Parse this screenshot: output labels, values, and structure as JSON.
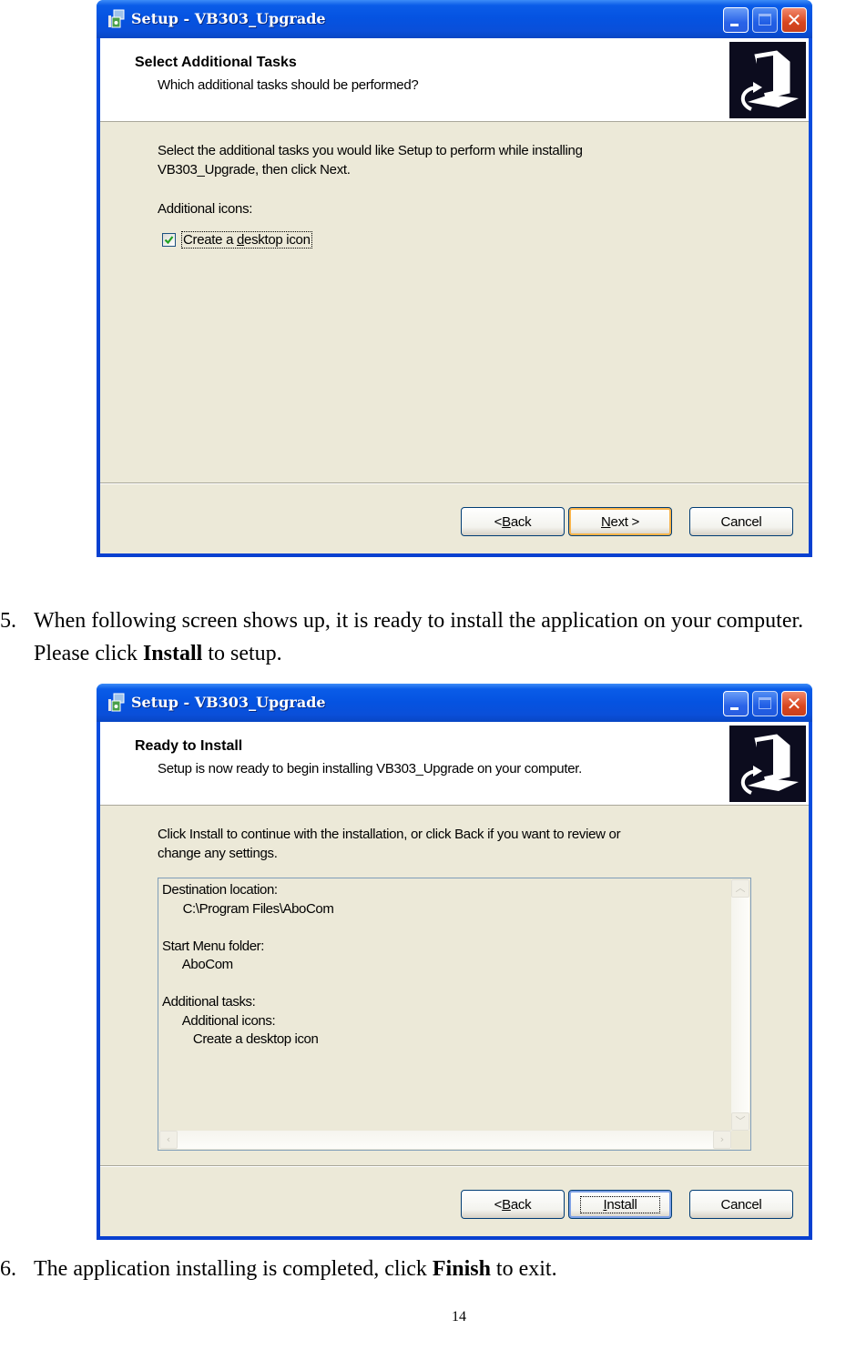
{
  "window1": {
    "title": "Setup - VB303_Upgrade",
    "header_title": "Select Additional Tasks",
    "header_subtitle": "Which additional tasks should be performed?",
    "body_line1": "Select the additional tasks you would like Setup to perform while installing",
    "body_line2": "VB303_Upgrade, then click Next.",
    "group_label": "Additional icons:",
    "checkbox": {
      "label_pre": "Create a ",
      "label_accel": "d",
      "label_post": "esktop icon",
      "checked": true
    },
    "buttons": {
      "back_pre": "< ",
      "back_accel": "B",
      "back_post": "ack",
      "next_accel": "N",
      "next_post": "ext >",
      "cancel": "Cancel"
    }
  },
  "step5": {
    "number": "5.",
    "text_pre": "When following screen shows up, it is ready to install the application on your computer. Please click ",
    "text_bold": "Install",
    "text_post": " to setup."
  },
  "window2": {
    "title": "Setup - VB303_Upgrade",
    "header_title": "Ready to Install",
    "header_subtitle": "Setup is now ready to begin installing VB303_Upgrade on your computer.",
    "body_line1": "Click Install to continue with the installation, or click Back if you want to review or",
    "body_line2": "change any settings.",
    "memo_lines": [
      "Destination location:",
      "      C:\\Program Files\\AboCom",
      "",
      "Start Menu folder:",
      "      AboCom",
      "",
      "Additional tasks:",
      "      Additional icons:",
      "         Create a desktop icon"
    ],
    "buttons": {
      "back_pre": "< ",
      "back_accel": "B",
      "back_post": "ack",
      "install_accel": "I",
      "install_post": "nstall",
      "cancel": "Cancel"
    }
  },
  "step6": {
    "number": "6.",
    "text_pre": "The application installing is completed, click ",
    "text_bold": "Finish",
    "text_post": " to exit."
  },
  "page_number": "14"
}
